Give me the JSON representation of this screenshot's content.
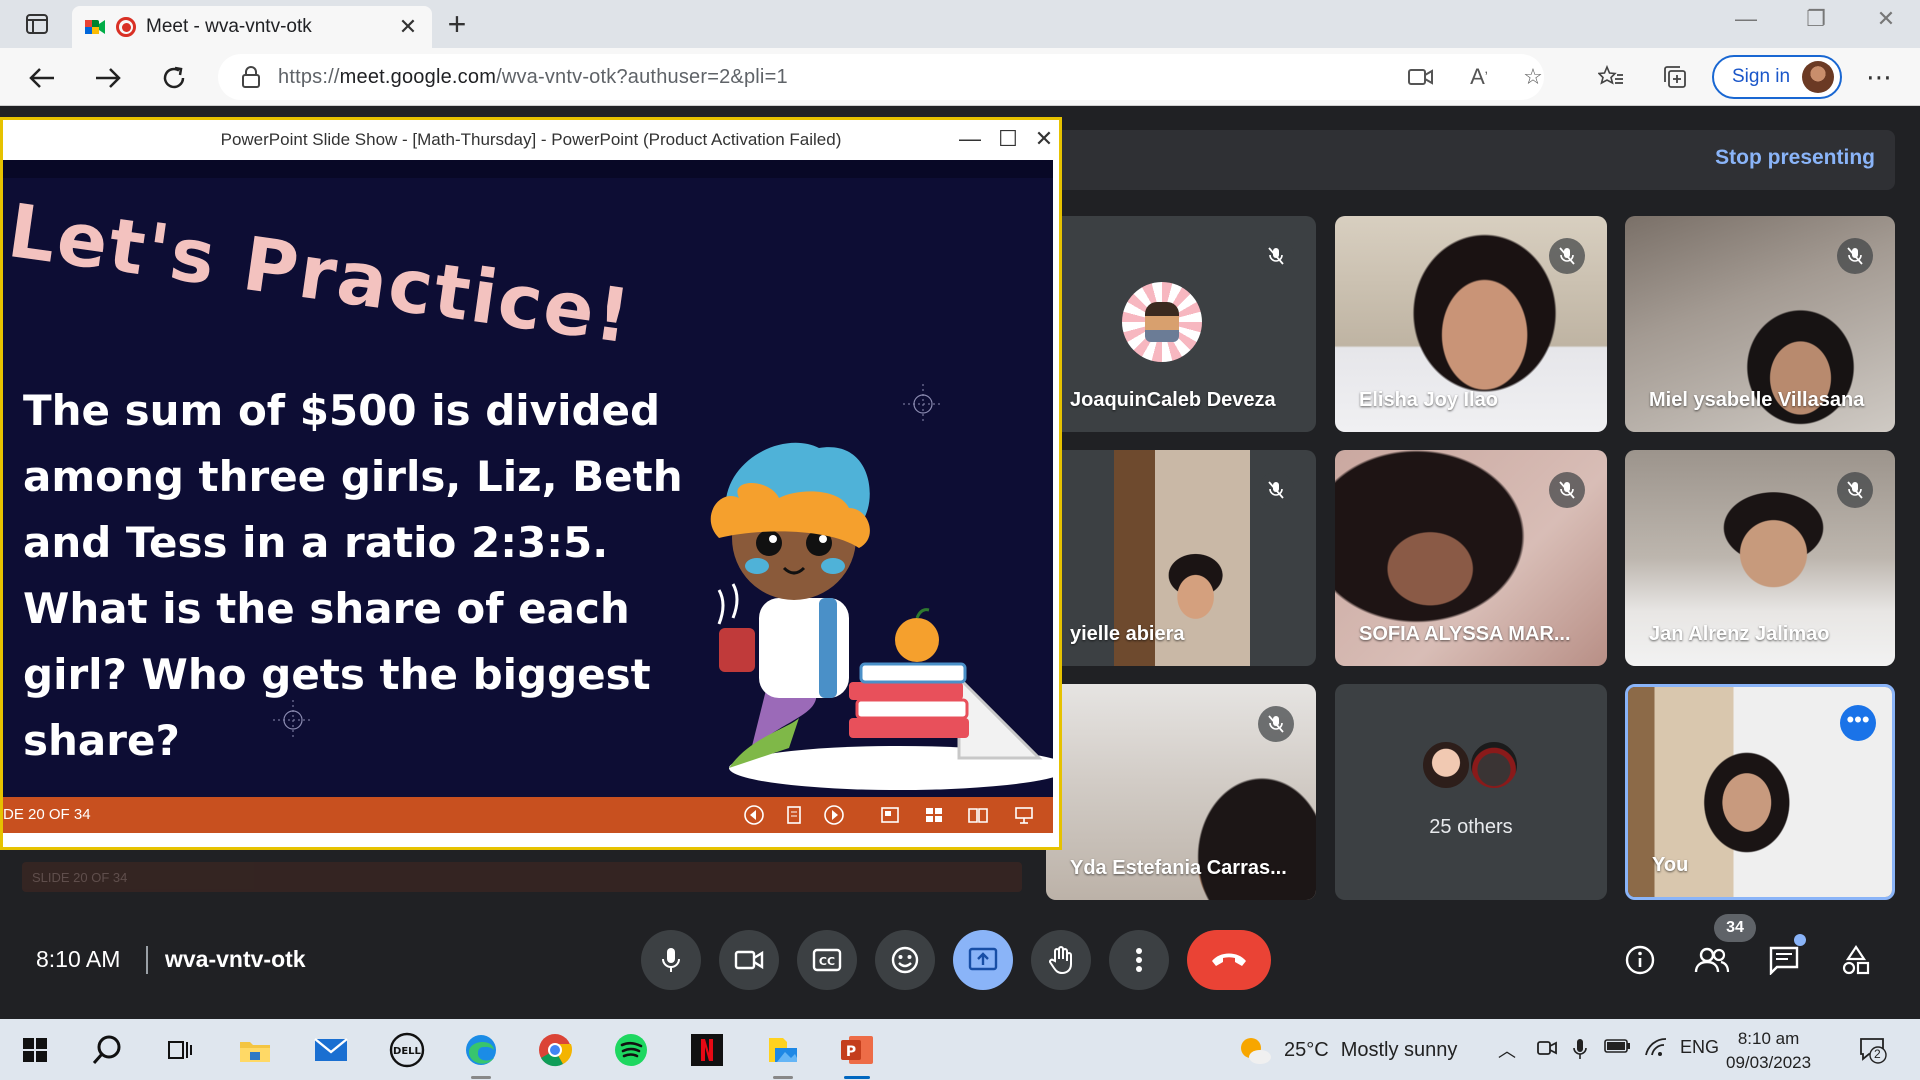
{
  "browser": {
    "tab_title": "Meet - wva-vntv-otk",
    "url_prefix": "https://",
    "url_host": "meet.google.com",
    "url_path": "/wva-vntv-otk?authuser=2&pli=1",
    "signin_label": "Sign in"
  },
  "powerpoint": {
    "window_title": "PowerPoint Slide Show - [Math-Thursday] - PowerPoint (Product Activation Failed)",
    "slide_heading": "Let's Practice!",
    "slide_body": "The sum of $500 is divided among three girls, Liz, Beth and Tess in a ratio 2:3:5. What is the share of each girl? Who gets the biggest share?",
    "slide_counter": "DE 20 OF 34",
    "ghost_counter": "SLIDE 20 OF 34"
  },
  "meet": {
    "stop_presenting": "Stop presenting",
    "participants": [
      {
        "name": "JoaquinCaleb Deveza"
      },
      {
        "name": "Elisha Joy Ilao"
      },
      {
        "name": "Miel ysabelle Villasana"
      },
      {
        "name": "yielle abiera"
      },
      {
        "name": "SOFIA ALYSSA MAR..."
      },
      {
        "name": "Jan Alrenz Jalimao"
      },
      {
        "name": "Yda Estefania Carras..."
      },
      {
        "name": "25 others"
      },
      {
        "name": "You"
      }
    ],
    "time": "8:10 AM",
    "meeting_code": "wva-vntv-otk",
    "people_count": "34"
  },
  "taskbar": {
    "weather_temp": "25°C",
    "weather_desc": "Mostly sunny",
    "language": "ENG",
    "clock_time": "8:10 am",
    "clock_date": "09/03/2023",
    "notification_count": "2"
  },
  "colors": {
    "meet_bg": "#202124",
    "tile_bg": "#3c4043",
    "accent_blue": "#8ab4f8",
    "end_call_red": "#ea4335",
    "ppt_orange": "#c8501f",
    "slide_navy": "#0d0d34",
    "slide_heading_pink": "#f3c2bf"
  },
  "icons": [
    "sidebar-icon",
    "meet-favicon",
    "recording-icon",
    "close-icon",
    "plus-icon",
    "back-arrow-icon",
    "forward-arrow-icon",
    "refresh-icon",
    "lock-icon",
    "camera-icon",
    "read-aloud-icon",
    "favorite-add-icon",
    "favorites-icon",
    "collections-icon",
    "more-icon",
    "mic-icon",
    "camera-icon",
    "captions-icon",
    "emoji-icon",
    "present-icon",
    "hand-icon",
    "more-vert-icon",
    "end-call-icon",
    "info-icon",
    "people-icon",
    "chat-icon",
    "activities-icon",
    "windows-start-icon",
    "search-icon",
    "task-view-icon",
    "file-explorer-icon",
    "mail-icon",
    "dell-icon",
    "edge-icon",
    "chrome-icon",
    "spotify-icon",
    "netflix-icon",
    "photos-icon",
    "powerpoint-icon"
  ]
}
